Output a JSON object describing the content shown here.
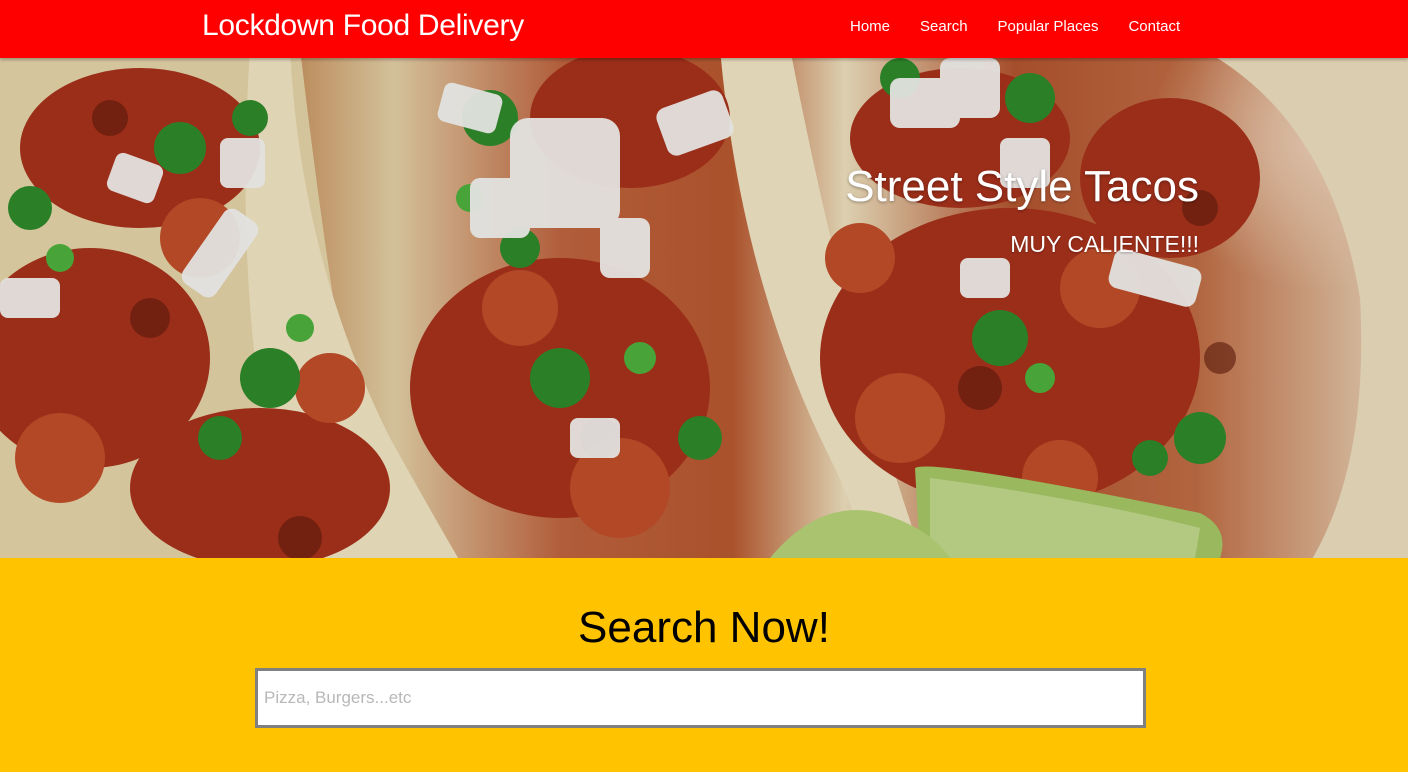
{
  "navbar": {
    "brand": "Lockdown Food Delivery",
    "links": [
      "Home",
      "Search",
      "Popular Places",
      "Contact"
    ],
    "background_color": "#ff0000"
  },
  "hero": {
    "image": "street-tacos-photo",
    "title": "Street Style Tacos",
    "subtitle": "MUY CALIENTE!!!"
  },
  "search": {
    "title": "Search Now!",
    "placeholder": "Pizza, Burgers...etc",
    "value": "",
    "background_color": "#ffc300"
  }
}
